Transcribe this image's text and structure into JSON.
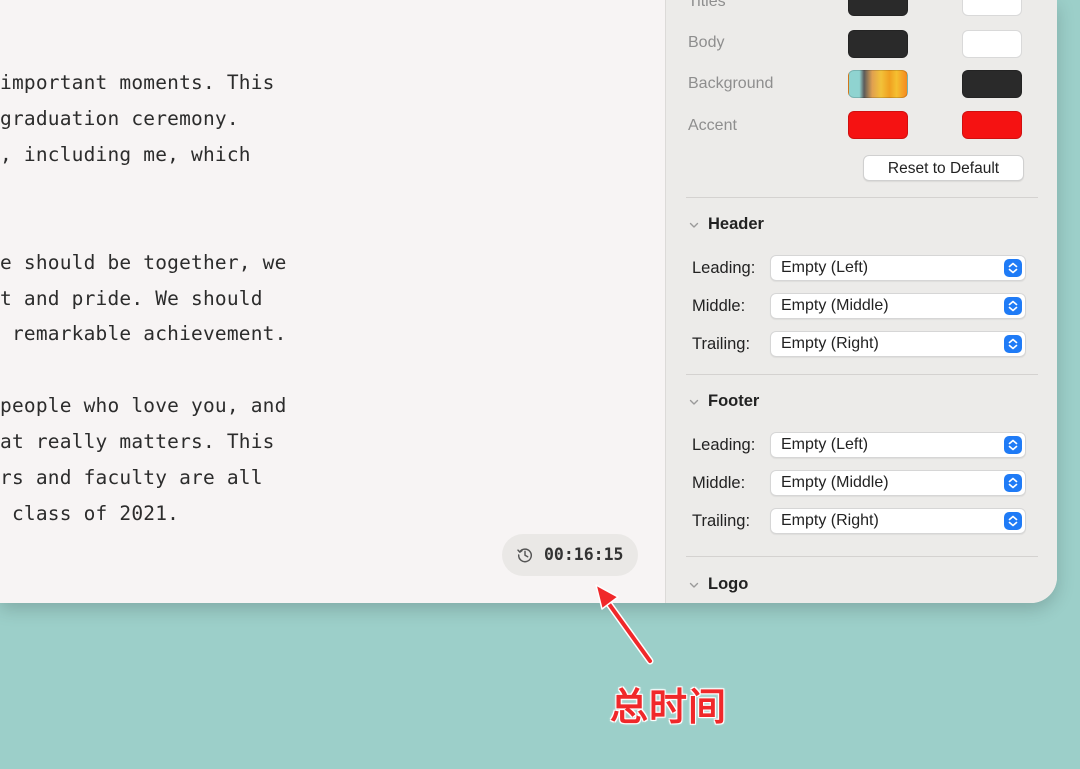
{
  "editor": {
    "lines": [
      "important moments. This",
      "graduation ceremony.",
      ", including me, which",
      "e should be together, we",
      "t and pride. We should",
      " remarkable achievement.",
      "people who love you, and",
      "at really matters. This",
      "rs and faculty are all",
      " class of 2021."
    ],
    "timer": {
      "icon": "history-clock-icon",
      "value": "00:16:15"
    }
  },
  "panel": {
    "colors": {
      "rows": [
        {
          "label": "Titles",
          "light": "#2a2a2a",
          "dark": "#ffffff"
        },
        {
          "label": "Body",
          "light": "#2a2a2a",
          "dark": "#ffffff"
        },
        {
          "label": "Background",
          "light": "gradient",
          "dark": "#2a2a2a"
        },
        {
          "label": "Accent",
          "light": "#f51212",
          "dark": "#f51212"
        }
      ],
      "reset_label": "Reset to Default"
    },
    "header": {
      "title": "Header",
      "rows": [
        {
          "label": "Leading:",
          "value": "Empty (Left)"
        },
        {
          "label": "Middle:",
          "value": "Empty (Middle)"
        },
        {
          "label": "Trailing:",
          "value": "Empty (Right)"
        }
      ]
    },
    "footer": {
      "title": "Footer",
      "rows": [
        {
          "label": "Leading:",
          "value": "Empty (Left)"
        },
        {
          "label": "Middle:",
          "value": "Empty (Middle)"
        },
        {
          "label": "Trailing:",
          "value": "Empty (Right)"
        }
      ]
    },
    "logo": {
      "title": "Logo"
    }
  },
  "annotation": {
    "text": "总时间",
    "color": "#f0282a"
  }
}
